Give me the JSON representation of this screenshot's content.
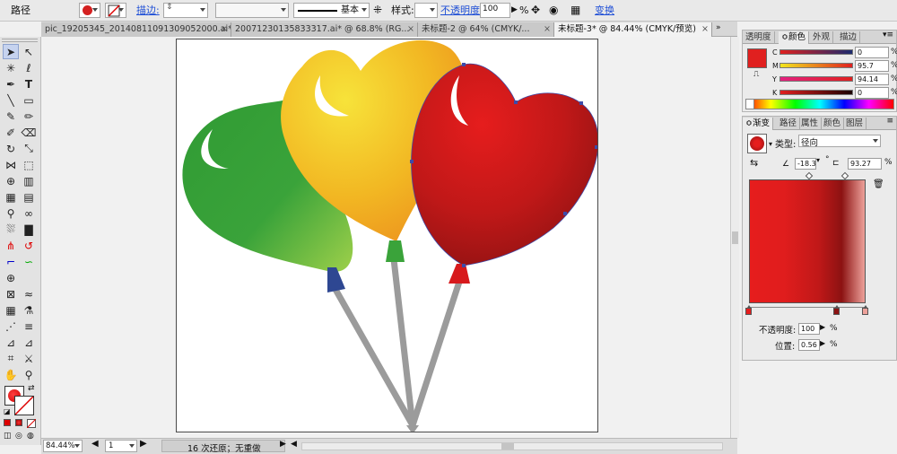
{
  "control_bar": {
    "object_type": "路径",
    "stroke_label": "描边:",
    "stroke_profile": "基本",
    "style_label": "样式:",
    "opacity_label": "不透明度:",
    "opacity_value": "100",
    "opacity_unit": "%",
    "transform_label": "变换",
    "fill_color": "#d42020"
  },
  "tabs": [
    {
      "label": "pic_19205345_20140811091309052000.ai*"
    },
    {
      "label": "20071230135833317.ai* @ 68.8% (RG..."
    },
    {
      "label": "未标题-2 @ 64% (CMYK/..."
    },
    {
      "label": "未标题-3* @ 84.44% (CMYK/预览)"
    }
  ],
  "status_bar": {
    "zoom": "84.44%",
    "artboard_number": "1",
    "status_text": "16 次还原；无重做"
  },
  "color_panel": {
    "tabs": [
      "透明度",
      "颜色",
      "外观",
      "描边"
    ],
    "active_tab": "颜色",
    "fill_color": "#e0201f",
    "channels": [
      {
        "label": "C",
        "value": "0"
      },
      {
        "label": "M",
        "value": "95.7"
      },
      {
        "label": "Y",
        "value": "94.14"
      },
      {
        "label": "K",
        "value": "0"
      }
    ]
  },
  "gradient_panel": {
    "tabs": [
      "渐变",
      "路径",
      "属性",
      "颜色",
      "图层"
    ],
    "active_tab": "渐变",
    "type_label": "类型:",
    "type_value": "径向",
    "angle_value": "-18.3",
    "angle_unit": "°",
    "aspect_value": "93.27",
    "aspect_unit": "%",
    "opacity_label": "不透明度:",
    "opacity_value": "100",
    "opacity_unit": "%",
    "location_label": "位置:",
    "location_value": "0.56",
    "location_unit": "%",
    "colors": {
      "start": "#e61d1d",
      "mid": "#c01818",
      "dark": "#8c1212",
      "end": "#eda19a"
    }
  },
  "artwork": {
    "balloon_colors": {
      "green": "#3aa33a",
      "yellow": "#f3c321",
      "red": "#d7191c",
      "stick": "#9b9b9b",
      "blue_knot": "#2e4792"
    }
  }
}
